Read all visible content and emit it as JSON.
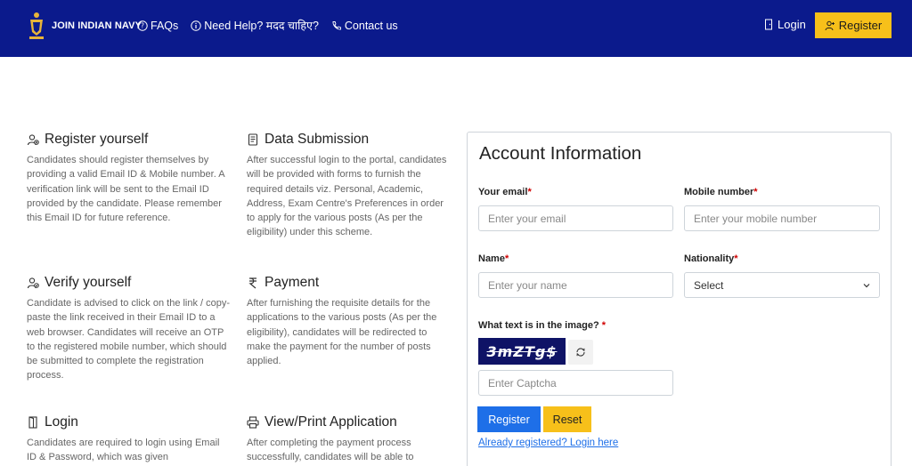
{
  "navbar": {
    "brand_label": "JOIN INDIAN NAVY",
    "links": [
      {
        "label": "FAQs",
        "icon": "question-circle-icon"
      },
      {
        "label": "Need Help? मदद चाहिए?",
        "icon": "info-circle-icon"
      },
      {
        "label": "Contact us",
        "icon": "phone-icon"
      }
    ],
    "login_label": "Login",
    "register_label": "Register",
    "bg_color": "#0b1a8c",
    "accent_color": "#f7c01a"
  },
  "info": [
    {
      "title": "Register yourself",
      "icon": "user-add-icon",
      "text": "Candidates should register themselves by providing a valid Email ID & Mobile number. A verification link will be sent to the Email ID provided by the candidate. Please remember this Email ID for future reference."
    },
    {
      "title": "Data Submission",
      "icon": "document-icon",
      "text": "After successful login to the portal, candidates will be provided with forms to furnish the required details viz. Personal, Academic, Address, Exam Centre's Preferences in order to apply for the various posts (As per the eligibility) under this scheme."
    },
    {
      "title": "Verify yourself",
      "icon": "user-check-icon",
      "text": "Candidate is advised to click on the link / copy-paste the link received in their Email ID to a web browser. Candidates will receive an OTP to the registered mobile number, which should be submitted to complete the registration process."
    },
    {
      "title": "Payment",
      "icon": "rupee-icon",
      "text": "After furnishing the requisite details for the applications to the various posts (As per the eligibility), candidates will be redirected to make the payment for the number of posts applied."
    },
    {
      "title": "Login",
      "icon": "door-icon",
      "text": "Candidates are required to login using Email ID & Password, which was given"
    },
    {
      "title": "View/Print Application",
      "icon": "printer-icon",
      "text": "After completing the payment process successfully, candidates will be able to"
    }
  ],
  "form": {
    "title": "Account Information",
    "email_label": "Your email",
    "email_placeholder": "Enter your email",
    "mobile_label": "Mobile number",
    "mobile_placeholder": "Enter your mobile number",
    "name_label": "Name",
    "name_placeholder": "Enter your name",
    "nationality_label": "Nationality",
    "nationality_value": "Select",
    "captcha_label": "What text is in the image?",
    "captcha_text": "3mZTg$",
    "captcha_placeholder": "Enter Captcha",
    "required_mark": "*",
    "register_button": "Register",
    "reset_button": "Reset",
    "already_registered": "Already registered? Login here"
  }
}
